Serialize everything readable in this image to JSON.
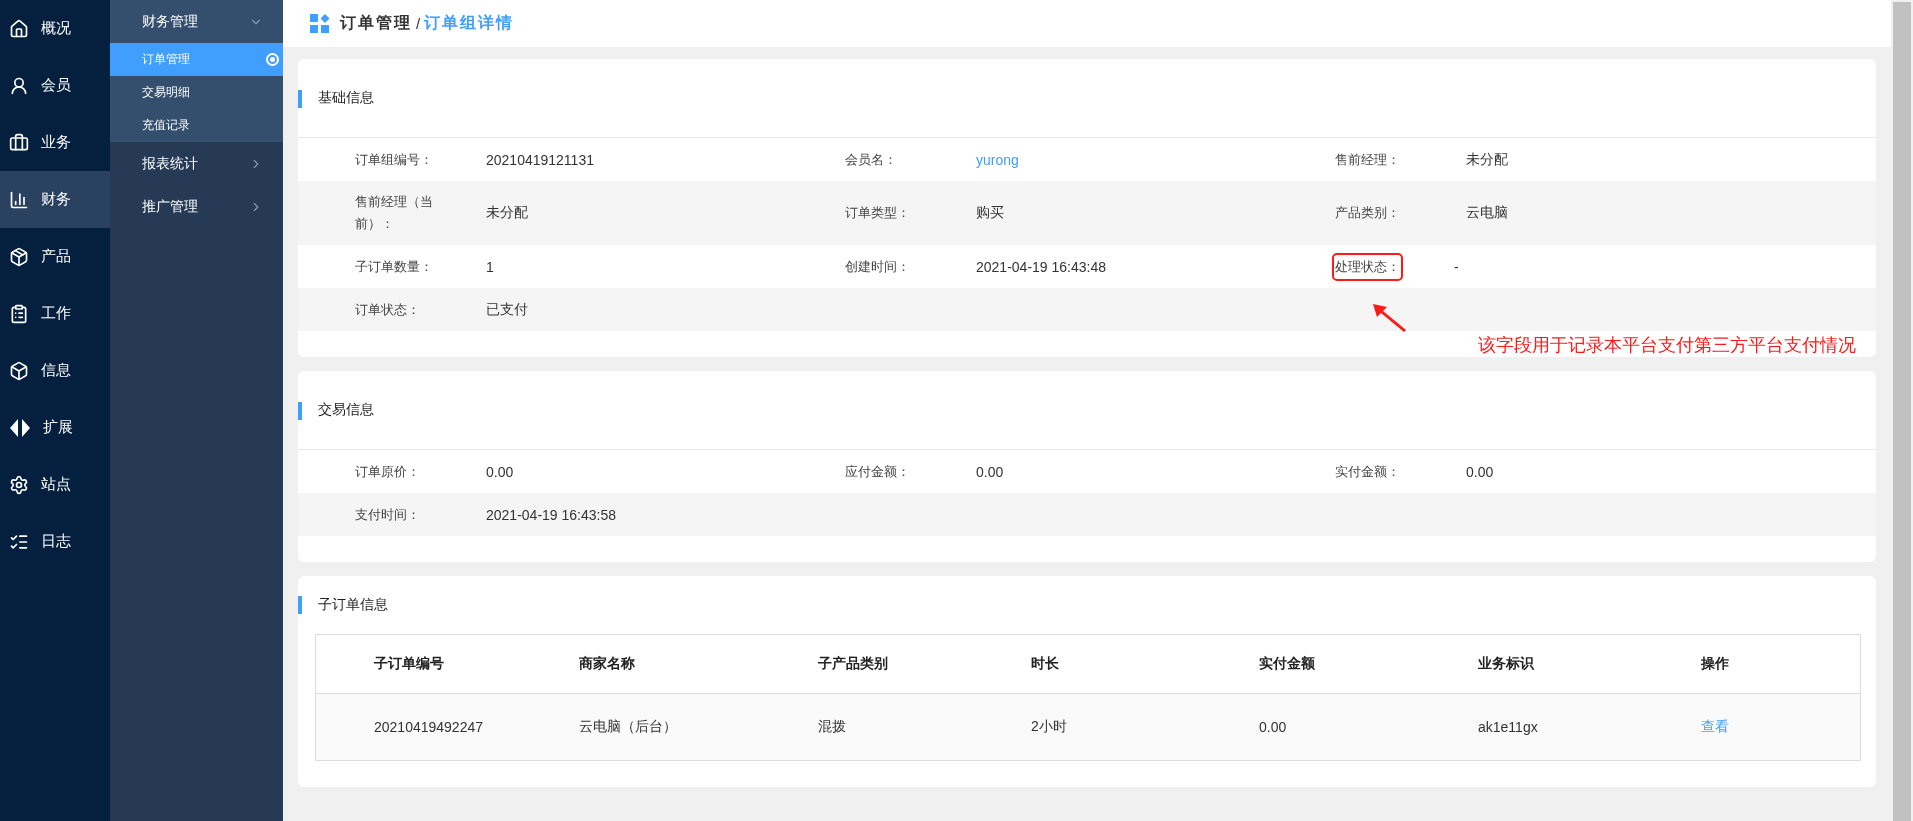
{
  "nav": {
    "items": [
      {
        "label": "概况",
        "selected": false
      },
      {
        "label": "会员",
        "selected": false
      },
      {
        "label": "业务",
        "selected": false
      },
      {
        "label": "财务",
        "selected": true
      },
      {
        "label": "产品",
        "selected": false
      },
      {
        "label": "工作",
        "selected": false
      },
      {
        "label": "信息",
        "selected": false
      },
      {
        "label": "扩展",
        "selected": false
      },
      {
        "label": "站点",
        "selected": false
      },
      {
        "label": "日志",
        "selected": false
      }
    ]
  },
  "submenu": {
    "groups": [
      {
        "label": "财务管理",
        "expanded": true,
        "items": [
          {
            "label": "订单管理",
            "selected": true
          },
          {
            "label": "交易明细",
            "selected": false
          },
          {
            "label": "充值记录",
            "selected": false
          }
        ]
      },
      {
        "label": "报表统计",
        "expanded": false
      },
      {
        "label": "推广管理",
        "expanded": false
      }
    ]
  },
  "breadcrumb": {
    "parent": "订单管理",
    "separator": "/",
    "current": "订单组详情"
  },
  "sections": [
    {
      "title": "基础信息",
      "rows": [
        [
          {
            "label": "订单组编号：",
            "value": "20210419121131",
            "kind": "text"
          },
          {
            "label": "会员名：",
            "value": "yurong",
            "kind": "link"
          },
          {
            "label": "售前经理：",
            "value": "未分配",
            "kind": "text"
          }
        ],
        [
          {
            "label": "售前经理（当前）：",
            "value": "未分配",
            "kind": "text"
          },
          {
            "label": "订单类型：",
            "value": "购买",
            "kind": "text"
          },
          {
            "label": "产品类别：",
            "value": "云电脑",
            "kind": "text"
          }
        ],
        [
          {
            "label": "子订单数量：",
            "value": "1",
            "kind": "text"
          },
          {
            "label": "创建时间：",
            "value": "2021-04-19 16:43:48",
            "kind": "text"
          },
          {
            "label": "处理状态：",
            "value": "-",
            "kind": "text",
            "highlighted": true
          }
        ],
        [
          {
            "label": "订单状态：",
            "value": "已支付",
            "kind": "text"
          }
        ]
      ],
      "callout": "该字段用于记录本平台支付第三方平台支付情况"
    },
    {
      "title": "交易信息",
      "rows": [
        [
          {
            "label": "订单原价：",
            "value": "0.00",
            "kind": "text"
          },
          {
            "label": "应付金额：",
            "value": "0.00",
            "kind": "text"
          },
          {
            "label": "实付金额：",
            "value": "0.00",
            "kind": "text"
          }
        ],
        [
          {
            "label": "支付时间：",
            "value": "2021-04-19 16:43:58",
            "kind": "text"
          }
        ]
      ]
    }
  ],
  "suborders": {
    "title": "子订单信息",
    "columns": [
      "子订单编号",
      "商家名称",
      "子产品类别",
      "时长",
      "实付金额",
      "业务标识",
      "操作"
    ],
    "rows": [
      {
        "cells": [
          "20210419492247",
          "云电脑（后台）",
          "混拨",
          "2小时",
          "0.00",
          "ak1e11gx"
        ],
        "action": "查看"
      }
    ]
  }
}
